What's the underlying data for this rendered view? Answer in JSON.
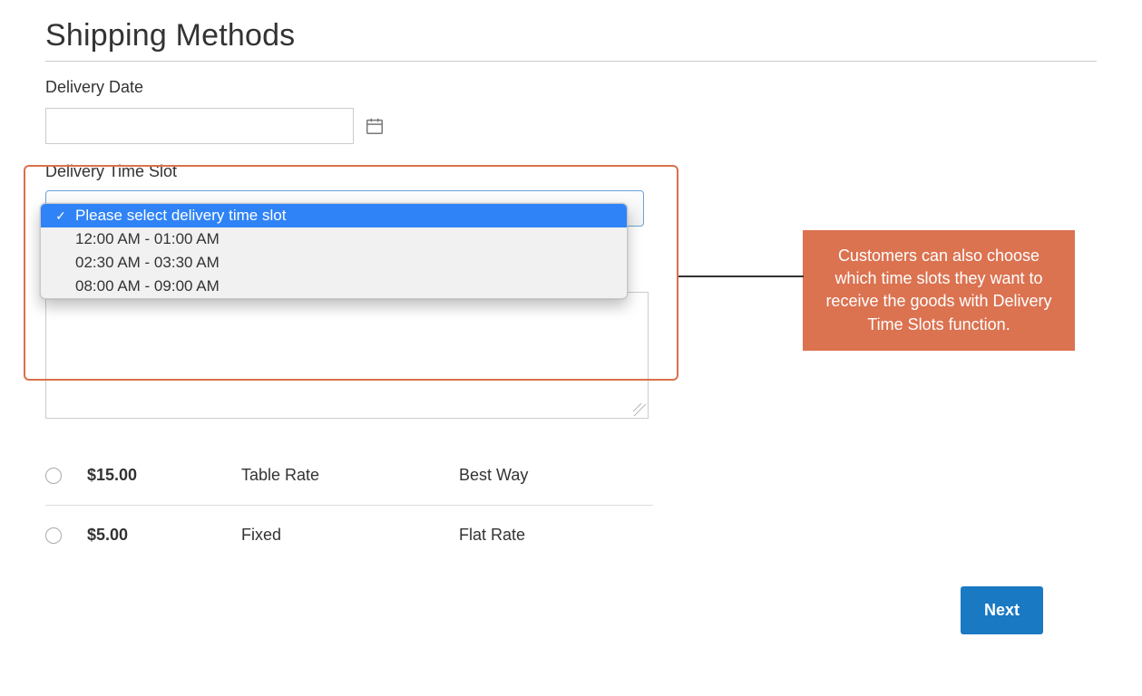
{
  "title": "Shipping Methods",
  "delivery_date": {
    "label": "Delivery Date",
    "value": ""
  },
  "time_slot": {
    "label": "Delivery Time Slot",
    "options": [
      "Please select delivery time slot",
      "12:00 AM - 01:00 AM",
      "02:30 AM - 03:30 AM",
      "08:00 AM - 09:00 AM"
    ],
    "selected_index": 0
  },
  "shipping_options": [
    {
      "price": "$15.00",
      "method": "Table Rate",
      "carrier": "Best Way"
    },
    {
      "price": "$5.00",
      "method": "Fixed",
      "carrier": "Flat Rate"
    }
  ],
  "next_label": "Next",
  "callout_text": "Customers can also choose which time slots they want to receive the goods with Delivery Time Slots function."
}
